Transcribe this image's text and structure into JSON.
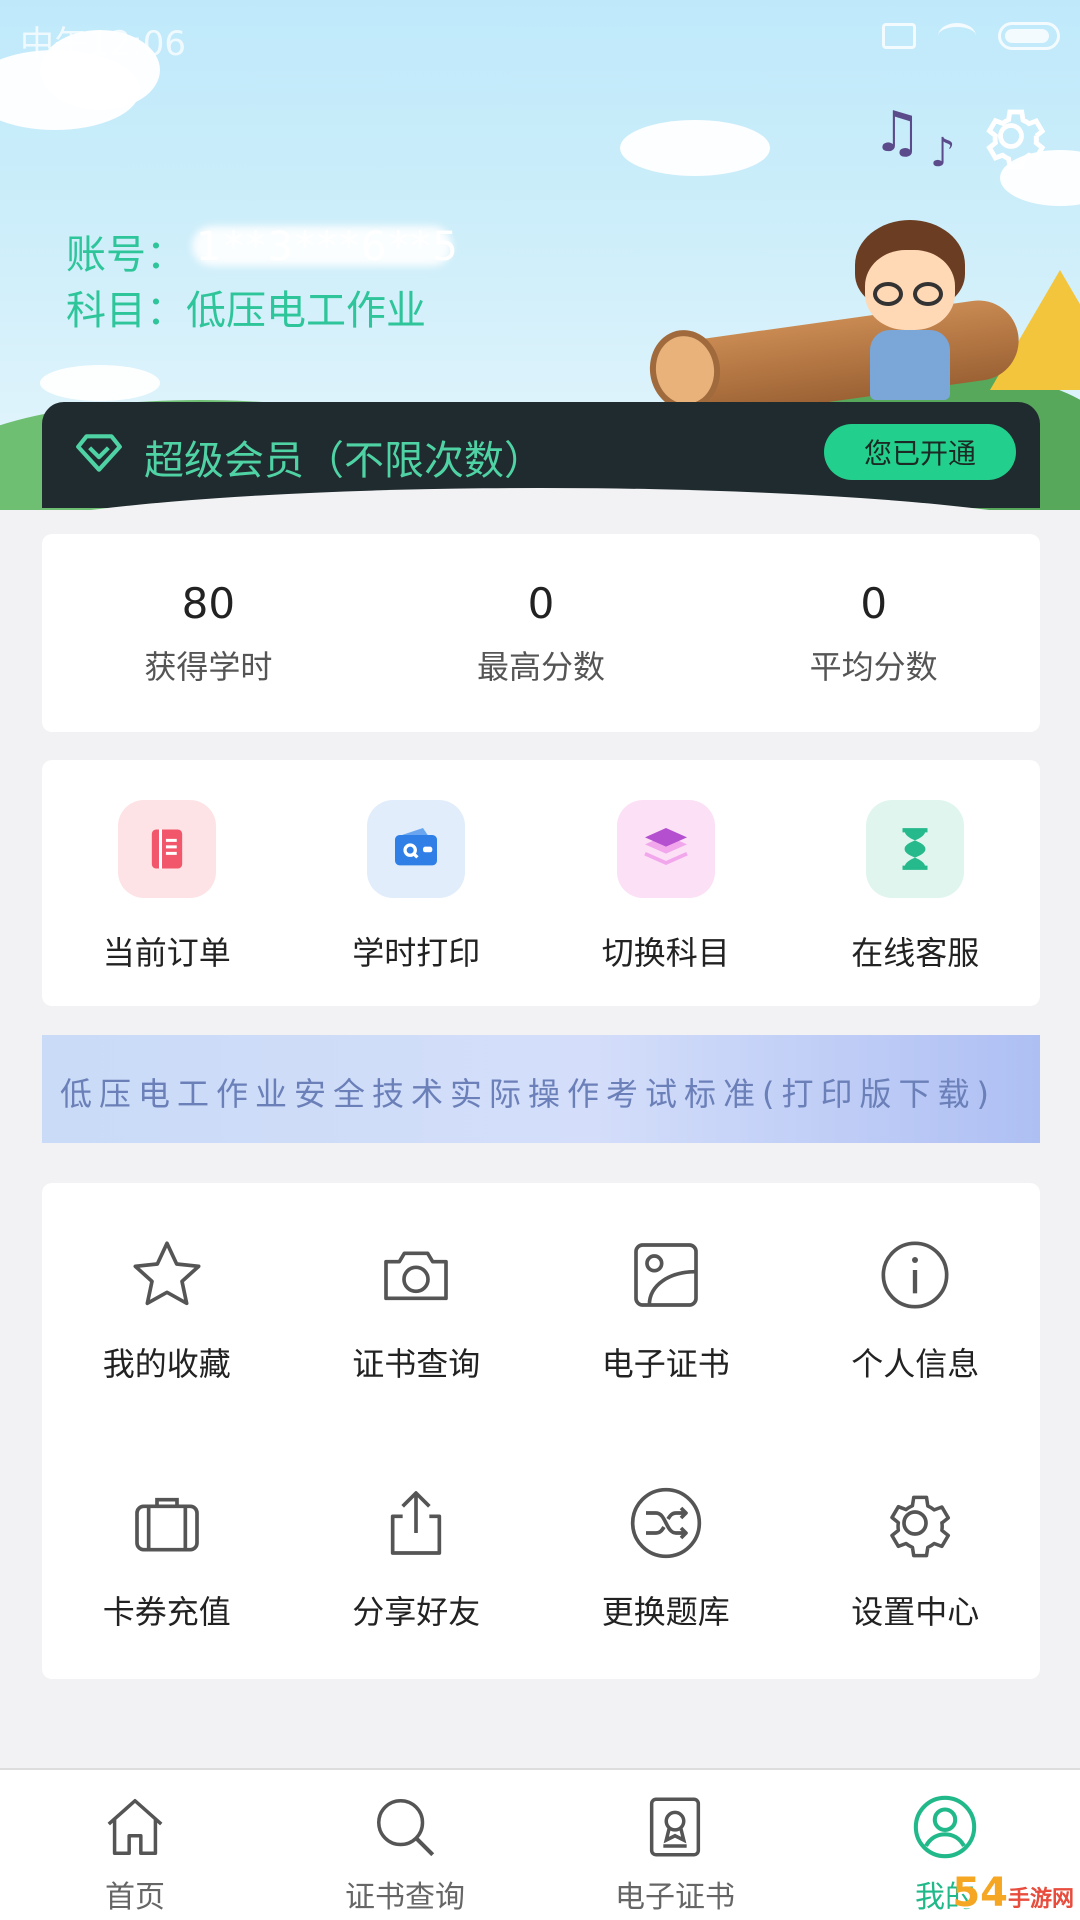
{
  "status_bar": {
    "time": "中午12:06"
  },
  "header": {
    "account_label": "账号：",
    "account_value": "1**3***6**5",
    "subject_label": "科目：",
    "subject_value": "低压电工作业"
  },
  "vip": {
    "title": "超级会员（不限次数）",
    "button": "您已开通",
    "accent": "#22cf8c"
  },
  "stats": [
    {
      "value": "80",
      "label": "获得学时"
    },
    {
      "value": "0",
      "label": "最高分数"
    },
    {
      "value": "0",
      "label": "平均分数"
    }
  ],
  "quick_actions": [
    {
      "label": "当前订单",
      "icon": "order-book-icon",
      "bg": "#fde3e6",
      "color": "#f2566b"
    },
    {
      "label": "学时打印",
      "icon": "wallet-print-icon",
      "bg": "#e1edfb",
      "color": "#2f7fe6"
    },
    {
      "label": "切换科目",
      "icon": "layers-icon",
      "bg": "#fbe0f6",
      "color": "#c759d8"
    },
    {
      "label": "在线客服",
      "icon": "hourglass-icon",
      "bg": "#dff5ee",
      "color": "#25b98b"
    }
  ],
  "banner": {
    "text": "低压电工作业安全技术实际操作考试标准(打印版下载)"
  },
  "menu": [
    {
      "label": "我的收藏",
      "icon": "star-icon"
    },
    {
      "label": "证书查询",
      "icon": "camera-icon"
    },
    {
      "label": "电子证书",
      "icon": "image-certificate-icon"
    },
    {
      "label": "个人信息",
      "icon": "info-icon"
    },
    {
      "label": "卡券充值",
      "icon": "briefcase-icon"
    },
    {
      "label": "分享好友",
      "icon": "share-icon"
    },
    {
      "label": "更换题库",
      "icon": "shuffle-icon"
    },
    {
      "label": "设置中心",
      "icon": "gear-icon"
    }
  ],
  "bottom_nav": [
    {
      "label": "首页",
      "icon": "home-icon",
      "active": false
    },
    {
      "label": "证书查询",
      "icon": "search-icon",
      "active": false
    },
    {
      "label": "电子证书",
      "icon": "certificate-icon",
      "active": false
    },
    {
      "label": "我的",
      "icon": "user-icon",
      "active": true
    }
  ],
  "watermark": {
    "main": "54",
    "sub": "手游网"
  }
}
